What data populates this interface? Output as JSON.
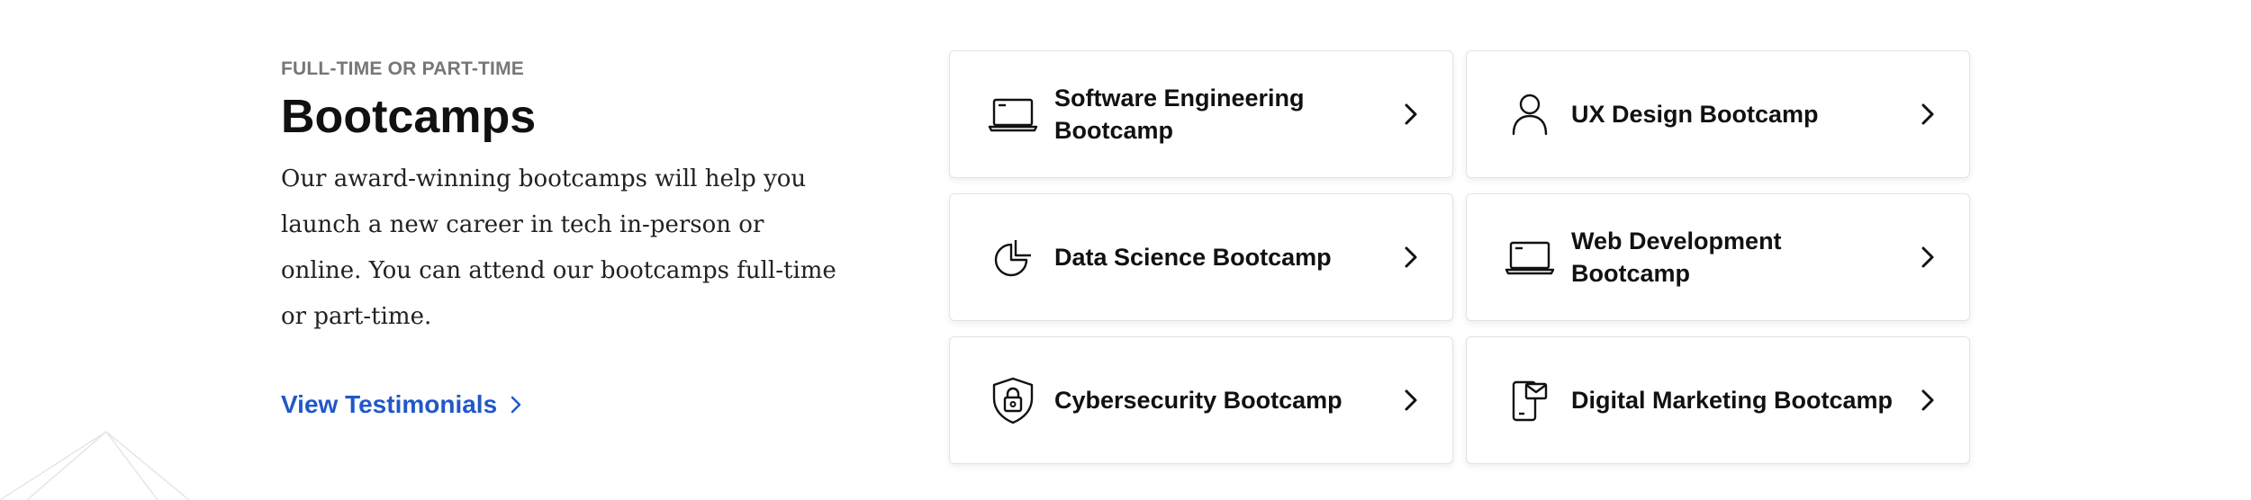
{
  "section": {
    "eyebrow": "FULL-TIME OR PART-TIME",
    "title": "Bootcamps",
    "description": "Our award-winning bootcamps will help you launch a new career in tech in-person or online. You can attend our bootcamps full-time or part-time.",
    "link_label": "View Testimonials"
  },
  "colors": {
    "link": "#2158c8",
    "eyebrow": "#777777"
  },
  "bootcamps": [
    {
      "label": "Software Engineering Bootcamp",
      "icon": "laptop-icon"
    },
    {
      "label": "UX Design Bootcamp",
      "icon": "user-icon"
    },
    {
      "label": "Data Science Bootcamp",
      "icon": "pie-chart-icon"
    },
    {
      "label": "Web Development Bootcamp",
      "icon": "laptop-icon"
    },
    {
      "label": "Cybersecurity Bootcamp",
      "icon": "shield-lock-icon"
    },
    {
      "label": "Digital Marketing Bootcamp",
      "icon": "phone-mail-icon"
    }
  ]
}
